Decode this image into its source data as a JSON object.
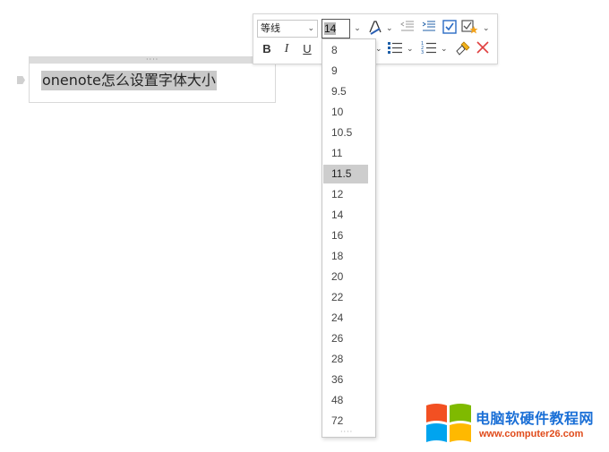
{
  "note": {
    "grip_glyph": "····",
    "text": "onenote怎么设置字体大小"
  },
  "toolbar": {
    "font_name": "等线",
    "font_size": "14",
    "bold_label": "B",
    "italic_label": "I",
    "underline_label": "U",
    "icons": [
      "font-color-icon",
      "decrease-indent-icon",
      "increase-indent-icon",
      "todo-tag-icon",
      "tag-star-icon",
      "highlight-icon",
      "bullets-icon",
      "numbering-icon",
      "format-painter-icon",
      "clear-formatting-icon"
    ]
  },
  "font_size_options": [
    "8",
    "9",
    "9.5",
    "10",
    "10.5",
    "11",
    "11.5",
    "12",
    "14",
    "16",
    "18",
    "20",
    "22",
    "24",
    "26",
    "28",
    "36",
    "48",
    "72"
  ],
  "highlighted_option": "11.5",
  "dropdown_grip": "····",
  "watermark": {
    "title": "电脑软硬件教程网",
    "url": "www.computer26.com",
    "colors": {
      "red": "#f25022",
      "green": "#7fba00",
      "blue": "#00a4ef",
      "yellow": "#ffb900"
    }
  }
}
